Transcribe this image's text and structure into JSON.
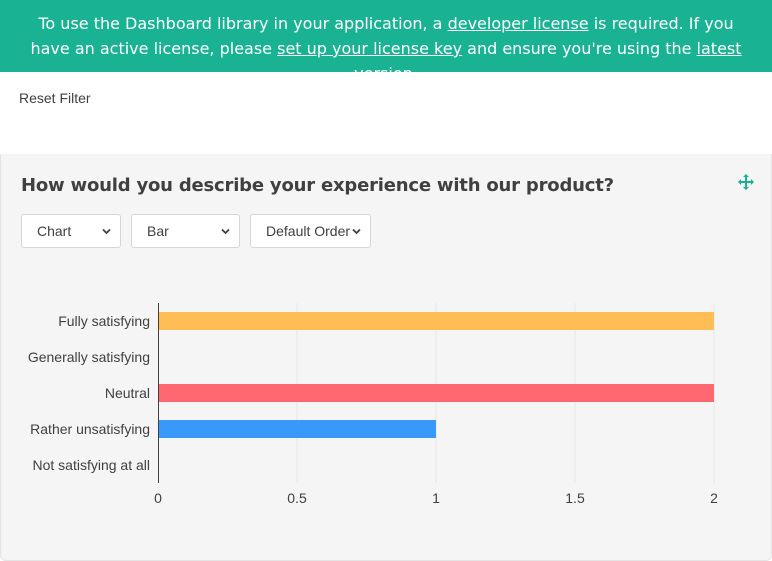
{
  "banner": {
    "text_1": "To use the Dashboard library in your application, a ",
    "link_1": "developer license",
    "text_2": " is required. If you have an active license, please ",
    "link_2": "set up your license key",
    "text_3": " and ensure you're using the ",
    "link_3": "latest version",
    "text_4": "."
  },
  "toolbar": {
    "reset_filter_label": "Reset Filter"
  },
  "question": {
    "title": "How would you describe your experience with our product?",
    "move_icon": "move-icon"
  },
  "selectors": {
    "visualizer": "Chart",
    "chart_type": "Bar",
    "order": "Default Order"
  },
  "colors": {
    "banner": "#19b394",
    "accent": "#19b394",
    "bar_fully_satisfying": "#ffbe55",
    "bar_neutral": "#ff6771",
    "bar_rather_unsatisfying": "#3999fb"
  },
  "chart_data": {
    "type": "bar",
    "orientation": "horizontal",
    "categories": [
      "Fully satisfying",
      "Generally satisfying",
      "Neutral",
      "Rather unsatisfying",
      "Not satisfying at all"
    ],
    "values": [
      2,
      0,
      2,
      1,
      0
    ],
    "colors": [
      "#ffbe55",
      "#9de000",
      "#ff6771",
      "#3999fb",
      "#1db496"
    ],
    "xlim": [
      0,
      2
    ],
    "xticks": [
      "0",
      "0.5",
      "1",
      "1.5",
      "2"
    ],
    "grid": true,
    "legend": "none"
  }
}
